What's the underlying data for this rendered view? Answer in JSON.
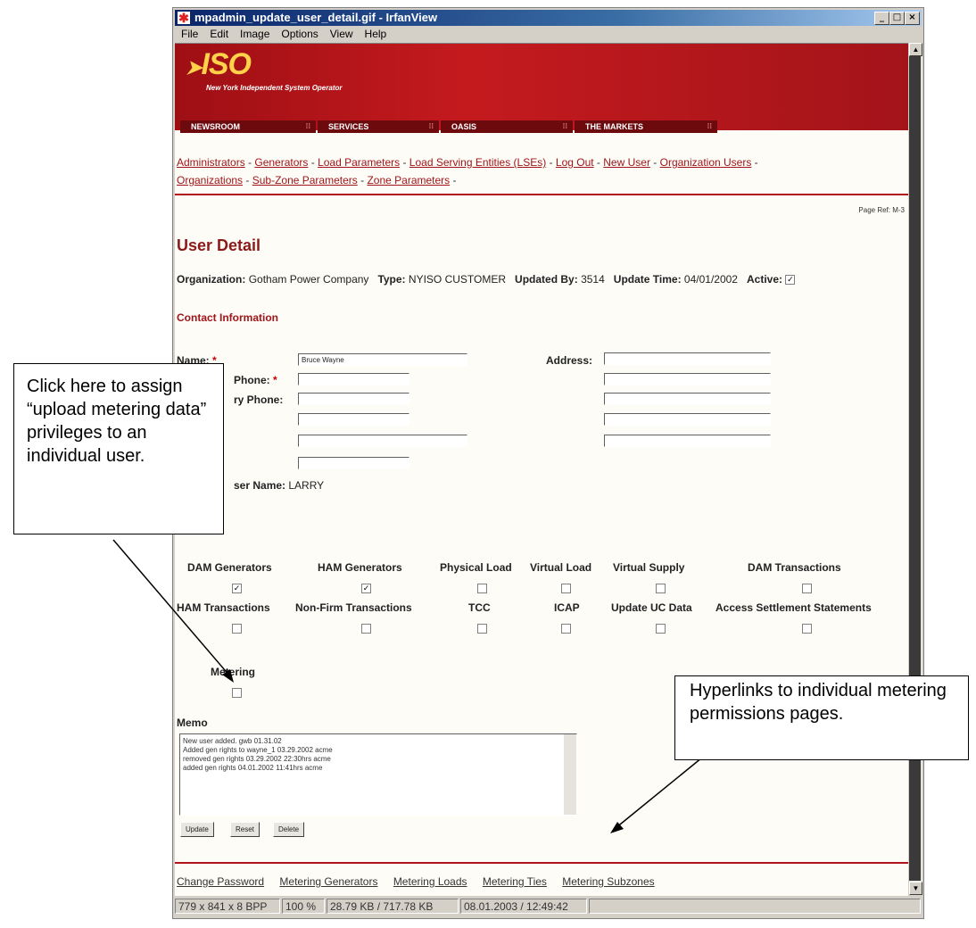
{
  "window": {
    "title": "mpadmin_update_user_detail.gif - IrfanView",
    "menu": [
      "File",
      "Edit",
      "Image",
      "Options",
      "View",
      "Help"
    ],
    "controls": {
      "minimize": "_",
      "maximize": "□",
      "close": "×"
    }
  },
  "banner": {
    "logo": "ISO",
    "tagline": "New York Independent System Operator",
    "tabs": [
      "NEWSROOM",
      "SERVICES",
      "OASIS",
      "THE MARKETS"
    ]
  },
  "nav_links": [
    "Administrators",
    "Generators",
    "Load Parameters",
    "Load Serving Entities (LSEs)",
    "Log Out",
    "New User",
    "Organization Users",
    "Organizations",
    "Sub-Zone Parameters",
    "Zone Parameters"
  ],
  "page_ref": "Page Ref: M-3",
  "page_title": "User Detail",
  "info": {
    "org_label": "Organization:",
    "org_value": "Gotham Power Company",
    "type_label": "Type:",
    "type_value": "NYISO CUSTOMER",
    "updated_by_label": "Updated By:",
    "updated_by_value": "3514",
    "update_time_label": "Update Time:",
    "update_time_value": "04/01/2002",
    "active_label": "Active:",
    "active_checked": true
  },
  "contact_section": "Contact Information",
  "fields": {
    "name_label": "Name:",
    "name_value": "Bruce Wayne",
    "phone_label": "Phone:",
    "secondary_phone_label": "ry Phone:",
    "address_label": "Address:",
    "username_label": "ser Name:",
    "username_value": "LARRY",
    "required_mark": "*"
  },
  "privileges": [
    {
      "label": "DAM Generators",
      "checked": true
    },
    {
      "label": "HAM Generators",
      "checked": true
    },
    {
      "label": "Physical Load",
      "checked": false
    },
    {
      "label": "Virtual Load",
      "checked": false
    },
    {
      "label": "Virtual Supply",
      "checked": false
    },
    {
      "label": "DAM Transactions",
      "checked": false
    },
    {
      "label": "HAM Transactions",
      "checked": false
    },
    {
      "label": "Non-Firm Transactions",
      "checked": false
    },
    {
      "label": "TCC",
      "checked": false
    },
    {
      "label": "ICAP",
      "checked": false
    },
    {
      "label": "Update UC Data",
      "checked": false
    },
    {
      "label": "Access Settlement Statements",
      "checked": false
    },
    {
      "label": "Metering",
      "checked": false
    }
  ],
  "memo": {
    "label": "Memo",
    "lines": [
      "New user added. gwb 01.31.02",
      "Added gen rights to wayne_1 03.29.2002 acme",
      "removed gen rights 03.29.2002 22:30hrs acme",
      "added gen rights 04.01.2002 11:41hrs acme"
    ]
  },
  "buttons": {
    "update": "Update",
    "reset": "Reset",
    "delete": "Delete"
  },
  "footer_links": [
    "Change Password",
    "Metering Generators",
    "Metering Loads",
    "Metering Ties",
    "Metering Subzones"
  ],
  "status": {
    "dims": "779 x 841 x 8 BPP",
    "zoom": "100 %",
    "size": "28.79 KB / 717.78 KB",
    "date": "08.01.2003 / 12:49:42"
  },
  "callouts": {
    "left": "Click here to assign “upload metering data” privileges to an individual user.",
    "right": "Hyperlinks to individual metering permissions pages."
  }
}
